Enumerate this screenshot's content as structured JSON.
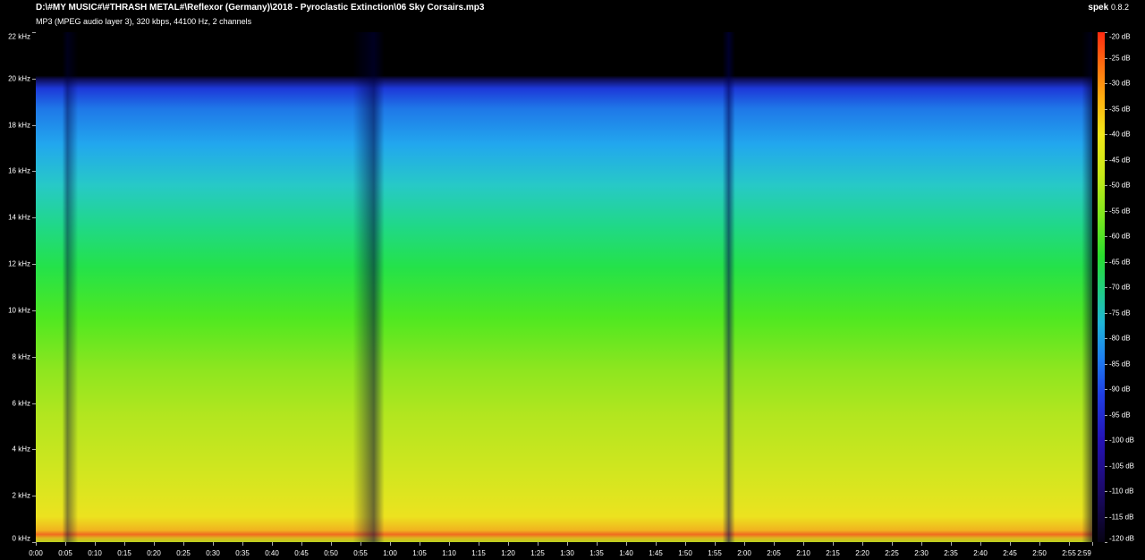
{
  "window": {
    "title": "D:\\#MY MUSIC#\\#THRASH METAL#\\Reflexor (Germany)\\2018 - Pyroclastic Extinction\\06 Sky Corsairs.mp3",
    "subtitle": "MP3 (MPEG audio layer 3), 320 kbps, 44100 Hz, 2 channels",
    "app_name": "spek",
    "app_version": "0.8.2"
  },
  "frequency_axis": {
    "labels": [
      "22 kHz",
      "20 kHz",
      "18 kHz",
      "16 kHz",
      "14 kHz",
      "12 kHz",
      "10 kHz",
      "8 kHz",
      "6 kHz",
      "4 kHz",
      "2 kHz",
      "0 kHz"
    ]
  },
  "time_axis": {
    "labels": [
      "0:00",
      "0:05",
      "0:10",
      "0:15",
      "0:20",
      "0:25",
      "0:30",
      "0:35",
      "0:40",
      "0:45",
      "0:50",
      "0:55",
      "1:00",
      "1:05",
      "1:10",
      "1:15",
      "1:20",
      "1:25",
      "1:30",
      "1:35",
      "1:40",
      "1:45",
      "1:50",
      "1:55",
      "2:00",
      "2:05",
      "2:10",
      "2:15",
      "2:20",
      "2:25",
      "2:30",
      "2:35",
      "2:40",
      "2:45",
      "2:50",
      "2:55",
      "2:59"
    ],
    "duration_seconds": 179
  },
  "db_scale": {
    "labels": [
      "-20 dB",
      "-25 dB",
      "-30 dB",
      "-35 dB",
      "-40 dB",
      "-45 dB",
      "-50 dB",
      "-55 dB",
      "-60 dB",
      "-65 dB",
      "-70 dB",
      "-75 dB",
      "-80 dB",
      "-85 dB",
      "-90 dB",
      "-95 dB",
      "-100 dB",
      "-105 dB",
      "-110 dB",
      "-115 dB",
      "-120 dB"
    ]
  },
  "spectrogram": {
    "cutoff_khz": 20,
    "max_khz": 22
  }
}
